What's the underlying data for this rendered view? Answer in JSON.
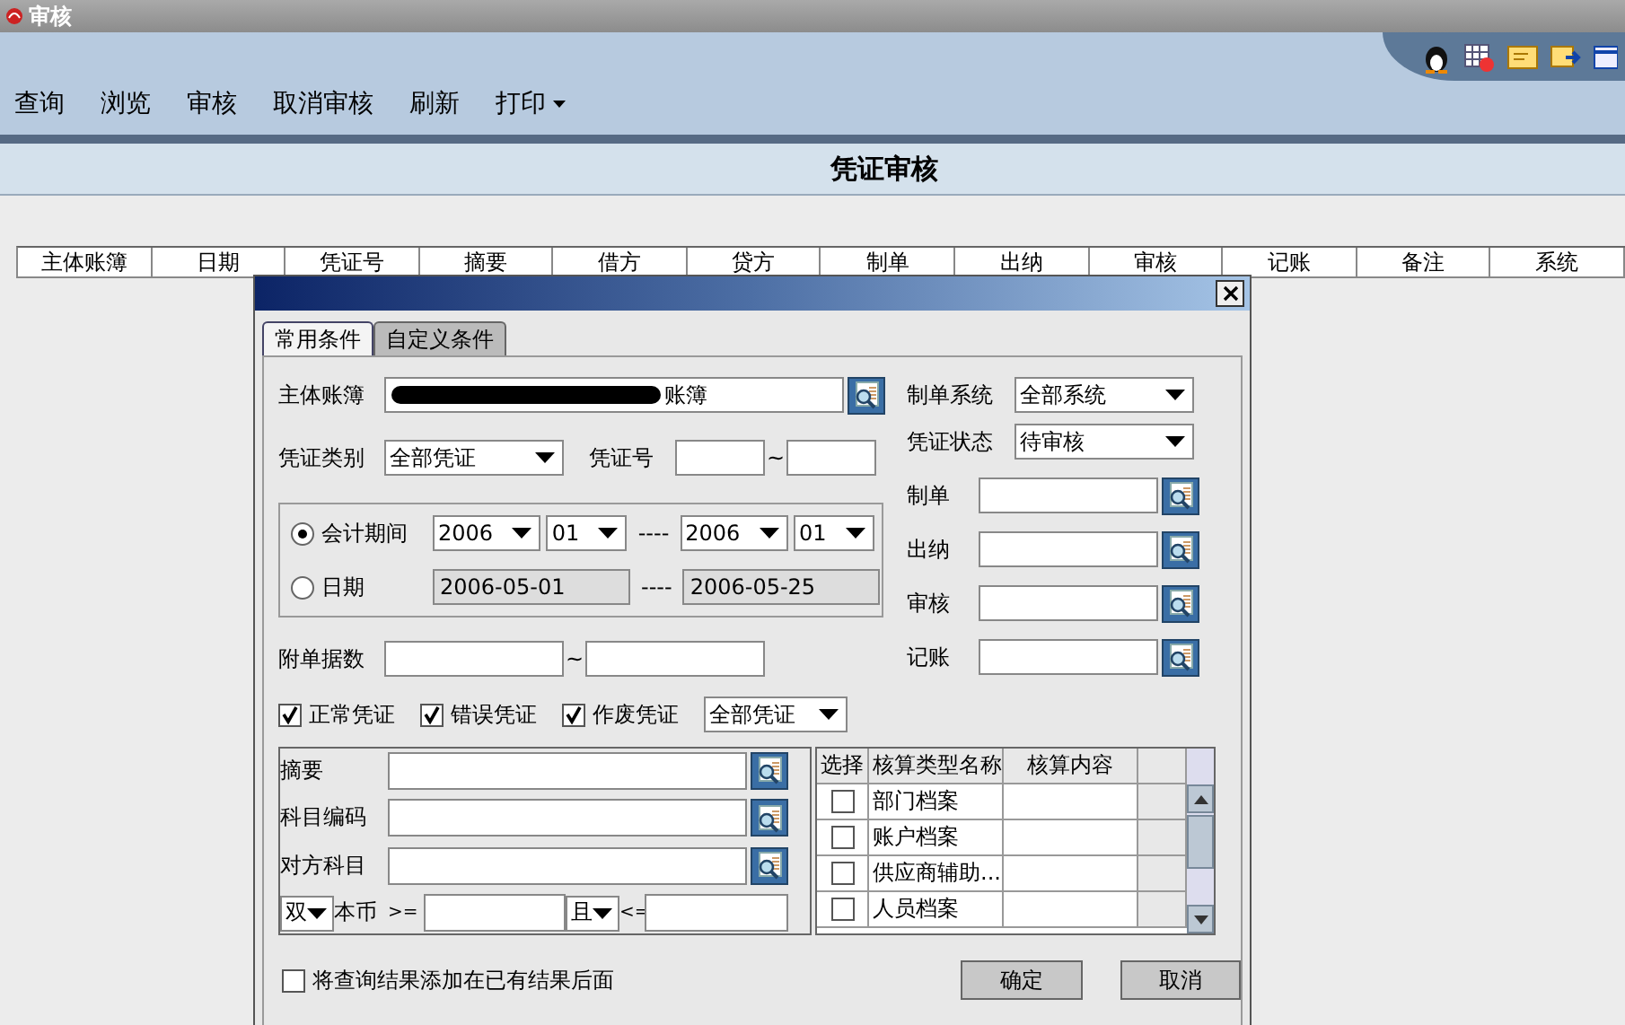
{
  "window": {
    "title": "审核"
  },
  "menu": [
    {
      "label": "查询",
      "dropdown": false
    },
    {
      "label": "浏览",
      "dropdown": false
    },
    {
      "label": "审核",
      "dropdown": false
    },
    {
      "label": "取消审核",
      "dropdown": false
    },
    {
      "label": "刷新",
      "dropdown": false
    },
    {
      "label": "打印",
      "dropdown": true
    }
  ],
  "page_title": "凭证审核",
  "table": {
    "columns": [
      "主体账簿",
      "日期",
      "凭证号",
      "摘要",
      "借方",
      "贷方",
      "制单",
      "出纳",
      "审核",
      "记账",
      "备注",
      "系统"
    ]
  },
  "dialog": {
    "tabs": [
      {
        "label": "常用条件",
        "selected": true
      },
      {
        "label": "自定义条件",
        "selected": false
      }
    ],
    "account_book": {
      "label": "主体账簿",
      "value": "账簿"
    },
    "voucher_type": {
      "label": "凭证类别",
      "value": "全部凭证"
    },
    "voucher_no": {
      "label": "凭证号",
      "separator": "~"
    },
    "period": {
      "label": "会计期间",
      "selected": true,
      "from_year": "2006",
      "from_month": "01",
      "dash": "----",
      "to_year": "2006",
      "to_month": "01"
    },
    "date": {
      "label": "日期",
      "selected": false,
      "from": "2006-05-01",
      "dash": "----",
      "to": "2006-05-25"
    },
    "attachments": {
      "label": "附单据数",
      "separator": "~"
    },
    "system": {
      "label": "制单系统",
      "value": "全部系统"
    },
    "status": {
      "label": "凭证状态",
      "value": "待审核"
    },
    "people": [
      {
        "label": "制单"
      },
      {
        "label": "出纳"
      },
      {
        "label": "审核"
      },
      {
        "label": "记账"
      }
    ],
    "voucher_flags": [
      {
        "label": "正常凭证",
        "checked": true
      },
      {
        "label": "错误凭证",
        "checked": true
      },
      {
        "label": "作废凭证",
        "checked": true
      }
    ],
    "flag_scope": "全部凭证",
    "conditions": [
      {
        "label": "摘要"
      },
      {
        "label": "科目编码"
      },
      {
        "label": "对方科目"
      }
    ],
    "amount": {
      "side": "双",
      "currency": "本币",
      "ge": ">=",
      "join": "且",
      "le": "<="
    },
    "aux_table": {
      "columns": [
        "选择",
        "核算类型名称",
        "核算内容"
      ],
      "rows": [
        {
          "checked": false,
          "name": "部门档案"
        },
        {
          "checked": false,
          "name": "账户档案"
        },
        {
          "checked": false,
          "name": "供应商辅助..."
        },
        {
          "checked": false,
          "name": "人员档案"
        }
      ]
    },
    "append": {
      "label": "将查询结果添加在已有结果后面",
      "checked": false
    },
    "buttons": [
      "确定",
      "取消"
    ]
  }
}
